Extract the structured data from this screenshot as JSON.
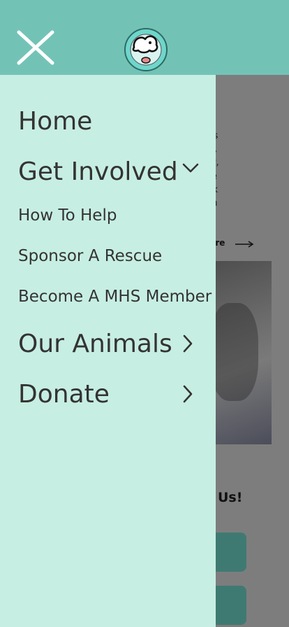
{
  "menu": {
    "home": "Home",
    "get_involved": "Get Involved",
    "how_to_help": "How To Help",
    "sponsor": "Sponsor A Rescue",
    "member": "Become A MHS Member",
    "our_animals": "Our Animals",
    "donate": "Donate"
  },
  "background": {
    "heading_fragment": "a",
    "paragraph_fragment": "es and cares\nn neglected,\nseek shelter,\nfe. We serve\nte a network\nty education\nnimals and\ncompanion",
    "read_more": "lore",
    "contact_fragment": "Us!"
  },
  "colors": {
    "header": "#72c3b6",
    "drawer": "#c7eee2",
    "text": "#333333"
  },
  "icons": {
    "close": "close-icon",
    "logo": "dog-logo-icon",
    "expand": "chevron-down-icon",
    "next": "chevron-right-icon"
  }
}
